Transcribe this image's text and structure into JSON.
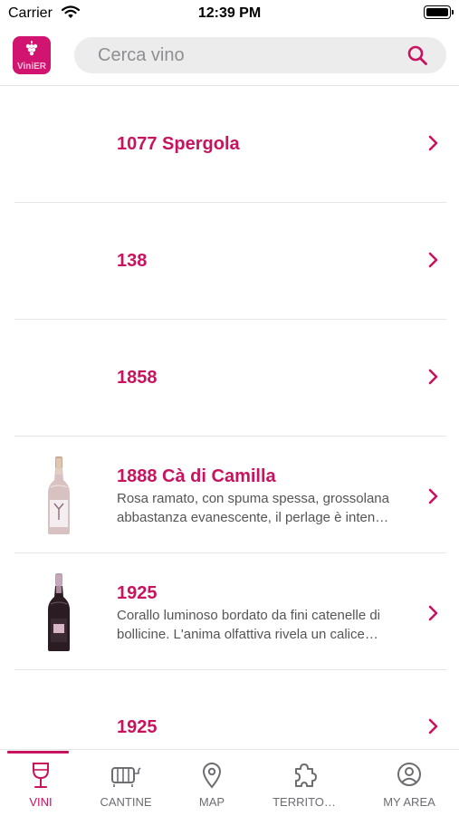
{
  "status_bar": {
    "carrier": "Carrier",
    "time": "12:39 PM"
  },
  "header": {
    "logo": {
      "text_main": "Vini",
      "text_accent": "ER"
    },
    "search": {
      "placeholder": "Cerca vino",
      "value": ""
    }
  },
  "colors": {
    "accent": "#c8135f",
    "logo_bg": "#d1146f",
    "text_secondary": "#555555",
    "separator": "#e6e6e6"
  },
  "wines": [
    {
      "name": "1077 Spergola",
      "description": [],
      "has_image": false
    },
    {
      "name": "138",
      "description": [],
      "has_image": false
    },
    {
      "name": "1858",
      "description": [],
      "has_image": false
    },
    {
      "name": "1888 Cà di Camilla",
      "description": [
        "Rosa ramato, con spuma spessa, grossolana",
        "abbastanza evanescente, il perlage è inten…"
      ],
      "has_image": true,
      "bottle": "sparkling-rose-bottle"
    },
    {
      "name": "1925",
      "description": [
        "Corallo luminoso bordato da fini catenelle di",
        "bollicine. L'anima olfattiva rivela un calice…"
      ],
      "has_image": true,
      "bottle": "dark-sparkling-bottle"
    },
    {
      "name": "1925",
      "description": [],
      "has_image": false
    }
  ],
  "tabs": [
    {
      "label": "VINI",
      "icon": "wine-glass-icon",
      "active": true
    },
    {
      "label": "CANTINE",
      "icon": "barrel-icon",
      "active": false
    },
    {
      "label": "MAP",
      "icon": "map-pin-icon",
      "active": false
    },
    {
      "label": "TERRITO…",
      "icon": "puzzle-icon",
      "active": false
    },
    {
      "label": "MY AREA",
      "icon": "user-circle-icon",
      "active": false
    }
  ]
}
